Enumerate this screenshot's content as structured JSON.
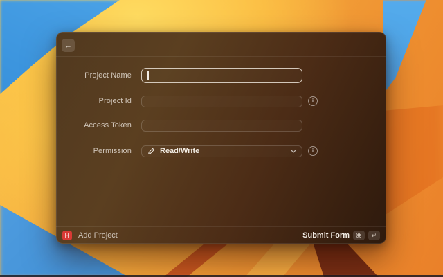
{
  "window": {
    "header": {
      "back_glyph": "←"
    },
    "form": {
      "info_glyph": "i",
      "fields": [
        {
          "label": "Project Name",
          "value": "",
          "state": "focused",
          "type": "text"
        },
        {
          "label": "Project Id",
          "value": "",
          "type": "text",
          "info": true
        },
        {
          "label": "Access Token",
          "value": "",
          "type": "text"
        },
        {
          "label": "Permission",
          "value": "Read/Write",
          "type": "dropdown",
          "info": true
        }
      ]
    },
    "footer": {
      "app_icon_letter": "H",
      "command_title": "Add Project",
      "primary_action": "Submit Form",
      "shortcuts": [
        "⌘",
        "↵"
      ]
    }
  },
  "colors": {
    "app_icon_bg": "#d93a35",
    "focus_ring": "#ded5c9",
    "window_tint_left": "#53391f",
    "window_tint_right": "#2e1a0d"
  }
}
